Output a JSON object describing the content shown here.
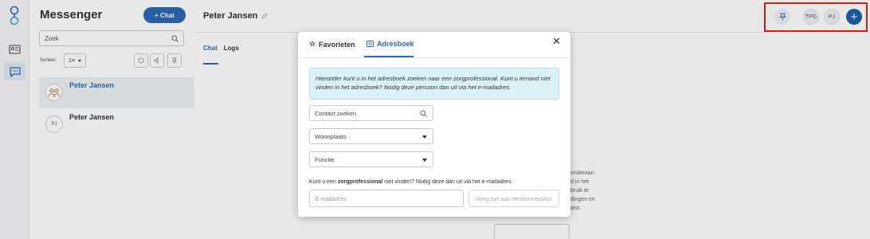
{
  "sidebar": {
    "title": "Messenger",
    "new_chat_label": "+ Chat",
    "search_placeholder": "Zoek",
    "sort_label": "Sorteer:",
    "sort_value": "1≡",
    "conversations": [
      {
        "name": "Peter Jansen",
        "initials": "",
        "selected": true
      },
      {
        "name": "Peter Jansen",
        "initials": "PJ",
        "selected": false
      }
    ]
  },
  "header": {
    "title": "Peter Jansen",
    "tabs": [
      {
        "label": "Chat"
      },
      {
        "label": "Logs"
      }
    ],
    "participants": [
      "TPG",
      "PJ"
    ],
    "add_label": "+"
  },
  "background_text": [
    "onderaan",
    "d in het",
    "bruik te",
    "dingen en",
    "atst."
  ],
  "modal": {
    "tabs": [
      {
        "label": "Favorieten",
        "icon": "star-icon"
      },
      {
        "label": "Adresboek",
        "icon": "addressbook-icon"
      }
    ],
    "close_label": "✕",
    "info_text": "Hieronder kunt u in het adresboek zoeken naar een zorgprofessional. Kunt u iemand niet vinden in het adresboek? Nodig deze persoon dan uit via het e-mailadres.",
    "contact_placeholder": "Contact zoeken",
    "woonplaats_label": "Woonplaats",
    "functie_label": "Functie",
    "invite_prefix": "Kunt u een ",
    "invite_bold": "zorgprofessional",
    "invite_suffix": " niet vinden? Nodig deze dan uit via het e-mailadres.",
    "email_placeholder": "E-mailadres",
    "add_button_label": "Voeg toe aan deelnemerslijst"
  },
  "colors": {
    "accent": "#2a6ab3",
    "highlight": "#e2231a",
    "info_bg": "#d9f1f7"
  }
}
